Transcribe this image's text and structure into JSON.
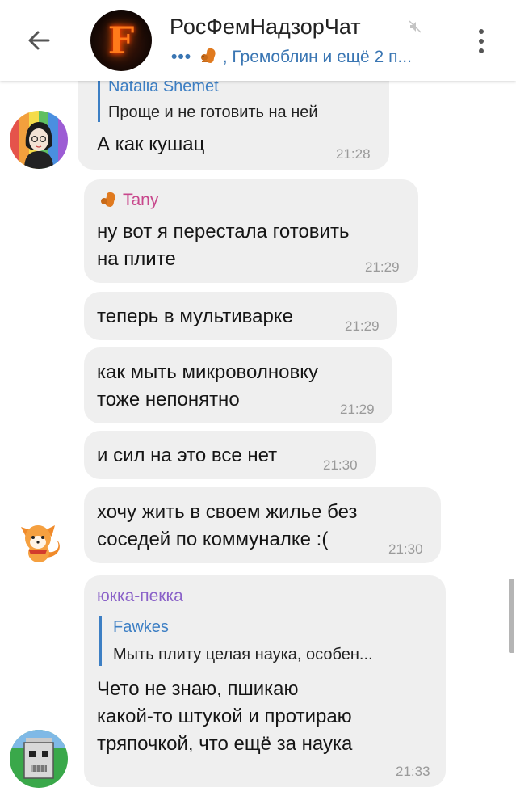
{
  "header": {
    "title": "РосФемНадзорЧат",
    "subtitle": ", Гремоблин и ещё 2 п...",
    "typing_dots": "•••",
    "avatar_letter": "F"
  },
  "messages": [
    {
      "quote_name": "Natalia Shemet",
      "quote_text": "Проще и не готовить на ней",
      "text": "А как кушац",
      "time": "21:28"
    },
    {
      "sender": "Tany",
      "sender_color": "#c8478c",
      "line1": "ну вот я перестала готовить",
      "line2": "на плите",
      "time": "21:29"
    },
    {
      "text": "теперь в мультиварке",
      "time": "21:29"
    },
    {
      "line1": "как мыть микроволновку",
      "line2": "тоже непонятно",
      "time": "21:29"
    },
    {
      "text": "и сил на это все нет",
      "time": "21:30"
    },
    {
      "line1": "хочу жить в своем жилье без",
      "line2": "соседей по коммуналке :(",
      "time": "21:30"
    },
    {
      "sender": "юкка-пекка",
      "sender_color": "#8a62c8",
      "quote_name": "Fawkes",
      "quote_text": "Мыть плиту целая наука, особен...",
      "line1": "Чето не знаю, пшикаю",
      "line2": "какой-то штукой и протираю",
      "line3": "тряпочкой, что ещё за наука",
      "time": "21:33"
    }
  ],
  "colors": {
    "accent": "#3a76b3",
    "bubble": "#efefef",
    "time": "#9a9a9a"
  }
}
